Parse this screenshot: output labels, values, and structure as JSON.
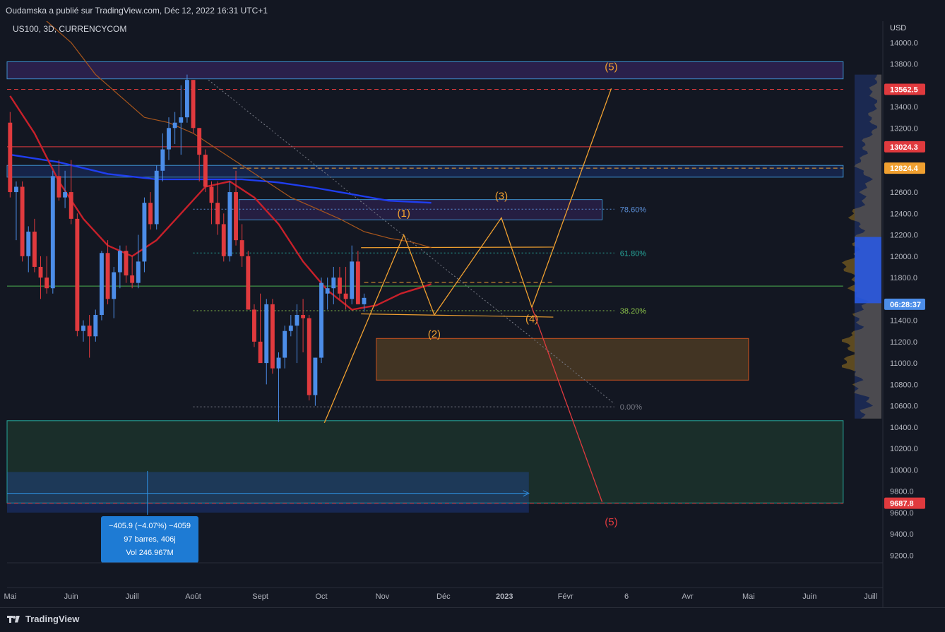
{
  "header": {
    "publisher_text": "Oudamska a publié sur TradingView.com, Déc 12, 2022 16:31 UTC+1",
    "symbol_text": "US100, 3D, CURRENCYCOM"
  },
  "footer": {
    "logo_text": "TradingView"
  },
  "colors": {
    "background": "#131722",
    "bull": "#4c8de8",
    "bear": "#e03a3e",
    "ma_blue": "#1f3ef0",
    "ma_red": "#c8202a",
    "ma_orange": "#a8561c",
    "wave_orange": "#f0a030",
    "red_line": "#e03a3e"
  },
  "chart_data": {
    "type": "candlestick",
    "price_axis": {
      "unit": "USD",
      "ticks": [
        "14000.0",
        "13800.0",
        "13400.0",
        "13200.0",
        "12600.0",
        "12400.0",
        "12200.0",
        "12000.0",
        "11800.0",
        "11400.0",
        "11200.0",
        "11000.0",
        "10800.0",
        "10600.0",
        "10400.0",
        "10200.0",
        "10000.0",
        "9800.0",
        "9600.0",
        "9400.0",
        "9200.0"
      ],
      "tick_values": [
        14000,
        13800,
        13400,
        13200,
        12600,
        12400,
        12200,
        12000,
        11800,
        11400,
        11200,
        11000,
        10800,
        10600,
        10400,
        10200,
        10000,
        9800,
        9600,
        9400,
        9200
      ],
      "ylim": [
        9130,
        14200
      ],
      "price_labels": [
        {
          "text": "13562.5",
          "value": 13562.5,
          "color": "#e03a3e"
        },
        {
          "text": "13024.3",
          "value": 13024.3,
          "color": "#e03a3e"
        },
        {
          "text": "12824.4",
          "value": 12824.4,
          "color": "#f0a030"
        },
        {
          "text": "06:28:37",
          "value": 11550,
          "color": "#4c8de8"
        },
        {
          "text": "9687.8",
          "value": 9687.8,
          "color": "#e03a3e"
        }
      ]
    },
    "time_axis": {
      "labels": [
        "Mai",
        "Juin",
        "Juill",
        "Août",
        "Sept",
        "Oct",
        "Nov",
        "Déc",
        "2023",
        "Févr",
        "6",
        "Avr",
        "Mai",
        "Juin",
        "Juill"
      ],
      "label_index": [
        0,
        10,
        20,
        30,
        41,
        51,
        61,
        71,
        81,
        91,
        101,
        111,
        121,
        131,
        141
      ],
      "xlim": [
        -0.5,
        143
      ]
    },
    "candles": [
      {
        "o": 13250,
        "h": 13350,
        "l": 12550,
        "c": 12600
      },
      {
        "o": 12600,
        "h": 12700,
        "l": 12150,
        "c": 12650
      },
      {
        "o": 12650,
        "h": 12700,
        "l": 11950,
        "c": 12000
      },
      {
        "o": 12000,
        "h": 12280,
        "l": 11850,
        "c": 12230
      },
      {
        "o": 12230,
        "h": 12350,
        "l": 11850,
        "c": 11900
      },
      {
        "o": 11900,
        "h": 12000,
        "l": 11600,
        "c": 11800
      },
      {
        "o": 11800,
        "h": 12000,
        "l": 11650,
        "c": 11700
      },
      {
        "o": 11700,
        "h": 12800,
        "l": 11650,
        "c": 12750
      },
      {
        "o": 12750,
        "h": 12900,
        "l": 12520,
        "c": 12550
      },
      {
        "o": 12550,
        "h": 12800,
        "l": 12450,
        "c": 12600
      },
      {
        "o": 12600,
        "h": 12900,
        "l": 12300,
        "c": 12350
      },
      {
        "o": 12350,
        "h": 12400,
        "l": 11250,
        "c": 11300
      },
      {
        "o": 11300,
        "h": 11400,
        "l": 11200,
        "c": 11350
      },
      {
        "o": 11350,
        "h": 11450,
        "l": 11050,
        "c": 11250
      },
      {
        "o": 11250,
        "h": 11500,
        "l": 11200,
        "c": 11450
      },
      {
        "o": 11450,
        "h": 12050,
        "l": 11400,
        "c": 12030
      },
      {
        "o": 12030,
        "h": 12150,
        "l": 11550,
        "c": 11600
      },
      {
        "o": 11600,
        "h": 11900,
        "l": 11420,
        "c": 11850
      },
      {
        "o": 11850,
        "h": 12100,
        "l": 11700,
        "c": 12050
      },
      {
        "o": 12050,
        "h": 12100,
        "l": 11750,
        "c": 11820
      },
      {
        "o": 11820,
        "h": 12000,
        "l": 11700,
        "c": 11750
      },
      {
        "o": 11750,
        "h": 12200,
        "l": 11700,
        "c": 11950
      },
      {
        "o": 11950,
        "h": 12550,
        "l": 11850,
        "c": 12500
      },
      {
        "o": 12500,
        "h": 12600,
        "l": 12250,
        "c": 12300
      },
      {
        "o": 12300,
        "h": 12850,
        "l": 12250,
        "c": 12800
      },
      {
        "o": 12800,
        "h": 13150,
        "l": 12700,
        "c": 13000
      },
      {
        "o": 13000,
        "h": 13300,
        "l": 12900,
        "c": 13200
      },
      {
        "o": 13200,
        "h": 13350,
        "l": 13050,
        "c": 13250
      },
      {
        "o": 13250,
        "h": 13600,
        "l": 12950,
        "c": 13300
      },
      {
        "o": 13300,
        "h": 13700,
        "l": 13250,
        "c": 13650
      },
      {
        "o": 13650,
        "h": 13650,
        "l": 13150,
        "c": 13200
      },
      {
        "o": 13200,
        "h": 13200,
        "l": 12700,
        "c": 12950
      },
      {
        "o": 12950,
        "h": 13000,
        "l": 12600,
        "c": 12650
      },
      {
        "o": 12650,
        "h": 12700,
        "l": 12300,
        "c": 12500
      },
      {
        "o": 12500,
        "h": 12700,
        "l": 12200,
        "c": 12300
      },
      {
        "o": 12300,
        "h": 12400,
        "l": 11950,
        "c": 12000
      },
      {
        "o": 12000,
        "h": 12700,
        "l": 11950,
        "c": 12600
      },
      {
        "o": 12600,
        "h": 12800,
        "l": 12100,
        "c": 12150
      },
      {
        "o": 12150,
        "h": 12300,
        "l": 11900,
        "c": 12000
      },
      {
        "o": 12000,
        "h": 12050,
        "l": 11500,
        "c": 11500
      },
      {
        "o": 11500,
        "h": 11550,
        "l": 11150,
        "c": 11200
      },
      {
        "o": 11200,
        "h": 11650,
        "l": 11100,
        "c": 11000
      },
      {
        "o": 11000,
        "h": 11600,
        "l": 10800,
        "c": 11550
      },
      {
        "o": 11550,
        "h": 11600,
        "l": 10900,
        "c": 10950
      },
      {
        "o": 10950,
        "h": 11100,
        "l": 10450,
        "c": 11050
      },
      {
        "o": 11050,
        "h": 11350,
        "l": 10950,
        "c": 11300
      },
      {
        "o": 11300,
        "h": 11450,
        "l": 11250,
        "c": 11350
      },
      {
        "o": 11350,
        "h": 11550,
        "l": 11000,
        "c": 11450
      },
      {
        "o": 11450,
        "h": 11600,
        "l": 11100,
        "c": 11420
      },
      {
        "o": 11420,
        "h": 11450,
        "l": 10650,
        "c": 10700
      },
      {
        "o": 10700,
        "h": 11050,
        "l": 10600,
        "c": 11050
      },
      {
        "o": 11050,
        "h": 11800,
        "l": 11000,
        "c": 11750
      },
      {
        "o": 11650,
        "h": 11800,
        "l": 11500,
        "c": 11700
      },
      {
        "o": 11700,
        "h": 11900,
        "l": 11550,
        "c": 11800
      },
      {
        "o": 11800,
        "h": 11900,
        "l": 11600,
        "c": 11650
      },
      {
        "o": 11650,
        "h": 11900,
        "l": 11500,
        "c": 11600
      },
      {
        "o": 11600,
        "h": 12100,
        "l": 11550,
        "c": 11950
      },
      {
        "o": 11950,
        "h": 12050,
        "l": 11550,
        "c": 11550
      },
      {
        "o": 11550,
        "h": 11650,
        "l": 11480,
        "c": 11610
      }
    ],
    "moving_averages": [
      {
        "color": "#1f3ef0",
        "points": [
          [
            0,
            12950
          ],
          [
            8,
            12880
          ],
          [
            16,
            12770
          ],
          [
            24,
            12720
          ],
          [
            32,
            12720
          ],
          [
            38,
            12720
          ],
          [
            44,
            12690
          ],
          [
            50,
            12640
          ],
          [
            56,
            12580
          ],
          [
            62,
            12520
          ],
          [
            69,
            12500
          ]
        ]
      },
      {
        "color": "#c8202a",
        "points": [
          [
            0,
            13500
          ],
          [
            4,
            13150
          ],
          [
            8,
            12700
          ],
          [
            12,
            12350
          ],
          [
            16,
            12100
          ],
          [
            20,
            12000
          ],
          [
            24,
            12150
          ],
          [
            28,
            12400
          ],
          [
            32,
            12650
          ],
          [
            36,
            12700
          ],
          [
            40,
            12550
          ],
          [
            44,
            12300
          ],
          [
            48,
            11950
          ],
          [
            52,
            11680
          ],
          [
            56,
            11500
          ],
          [
            60,
            11540
          ],
          [
            64,
            11650
          ],
          [
            68,
            11720
          ],
          [
            69,
            11740
          ]
        ]
      },
      {
        "color": "#a8561c",
        "points": [
          [
            5,
            14250
          ],
          [
            10,
            14000
          ],
          [
            14,
            13700
          ],
          [
            18,
            13500
          ],
          [
            22,
            13300
          ],
          [
            26,
            13250
          ],
          [
            30,
            13150
          ],
          [
            34,
            13000
          ],
          [
            38,
            12850
          ],
          [
            42,
            12700
          ],
          [
            46,
            12550
          ],
          [
            50,
            12450
          ],
          [
            54,
            12350
          ],
          [
            58,
            12230
          ],
          [
            62,
            12170
          ],
          [
            66,
            12130
          ],
          [
            69,
            12080
          ]
        ]
      }
    ],
    "fib_levels": [
      {
        "label": "78.60%",
        "value": 12440,
        "color": "#5b8fd8",
        "x_end": 99
      },
      {
        "label": "61.80%",
        "value": 12030,
        "color": "#26a69a",
        "x_end": 99
      },
      {
        "label": "38.20%",
        "value": 11490,
        "color": "#8bc34a",
        "x_end": 99
      },
      {
        "label": "0.00%",
        "value": 10590,
        "color": "#787b86",
        "x_end": 99
      }
    ],
    "zones": [
      {
        "x0": -0.5,
        "x1": 136.5,
        "y0": 13660,
        "y1": 13820,
        "fill": "rgba(103,58,183,0.28)",
        "stroke": "#3d8ecb"
      },
      {
        "x0": -0.5,
        "x1": 136.5,
        "y0": 12740,
        "y1": 12850,
        "fill": "rgba(41,98,255,0.18)",
        "stroke": "#3d8ecb"
      },
      {
        "x0": 37.5,
        "x1": 97,
        "y0": 12340,
        "y1": 12530,
        "fill": "rgba(103,58,183,0.22)",
        "stroke": "#3d8ecb"
      },
      {
        "x0": 60,
        "x1": 121,
        "y0": 10840,
        "y1": 11230,
        "fill": "rgba(191,128,41,0.28)",
        "stroke": "#c7511f"
      },
      {
        "x0": -0.5,
        "x1": 136.5,
        "y0": 9690,
        "y1": 10460,
        "fill": "rgba(48,107,64,0.28)",
        "stroke": "#26a69a"
      },
      {
        "x0": -0.5,
        "x1": 85,
        "y0": 9600,
        "y1": 9980,
        "fill": "rgba(41,98,255,0.22)",
        "stroke": "none"
      }
    ],
    "hlines": [
      {
        "value": 13562.5,
        "color": "#e03a3e",
        "dash": "6,4",
        "x0": -0.5,
        "x1": 136.5
      },
      {
        "value": 13024.3,
        "color": "#e03a3e",
        "dash": "",
        "x0": -0.5,
        "x1": 136.5
      },
      {
        "value": 12824.4,
        "color": "#f0a030",
        "dash": "6,4",
        "x0": 36.5,
        "x1": 136.5
      },
      {
        "value": 11720,
        "color": "#4caf50",
        "dash": "",
        "x0": -0.5,
        "x1": 136.5
      },
      {
        "value": 11755,
        "color": "#f0a030",
        "dash": "6,4",
        "x0": 58,
        "x1": 89
      },
      {
        "value": 9687.8,
        "color": "#e03a3e",
        "dash": "6,4",
        "x0": -0.5,
        "x1": 136.5
      }
    ],
    "wave_path": [
      [
        51.5,
        10440
      ],
      [
        64.5,
        12200
      ],
      [
        69.5,
        11450
      ],
      [
        80.5,
        12360
      ],
      [
        85.5,
        11520
      ],
      [
        98.5,
        13570
      ]
    ],
    "wave_labels": [
      {
        "text": "(1)",
        "x": 64.5,
        "y": 12370
      },
      {
        "text": "(2)",
        "x": 69.5,
        "y": 11240
      },
      {
        "text": "(3)",
        "x": 80.5,
        "y": 12530
      },
      {
        "text": "(4)",
        "x": 85.5,
        "y": 11380
      },
      {
        "text": "(5)",
        "x": 98.5,
        "y": 13740
      }
    ],
    "bear_path": [
      [
        85.5,
        11520
      ],
      [
        97,
        9700
      ]
    ],
    "bear_label": {
      "text": "(5)",
      "x": 98.5,
      "y": 9480
    },
    "wedge_lines": [
      [
        [
          57.5,
          12080
        ],
        [
          89,
          12085
        ]
      ],
      [
        [
          57.5,
          11460
        ],
        [
          89,
          11430
        ]
      ]
    ],
    "trend_line": [
      [
        32.5,
        13650
      ],
      [
        99,
        10620
      ]
    ],
    "measure": {
      "x0": -0.5,
      "x1": 85,
      "value": 9780,
      "marker_x": 22.5,
      "line1": "−405.9 (−4.07%) −4059",
      "line2": "97 barres, 406j",
      "line3": "Vol 246.967M"
    }
  }
}
